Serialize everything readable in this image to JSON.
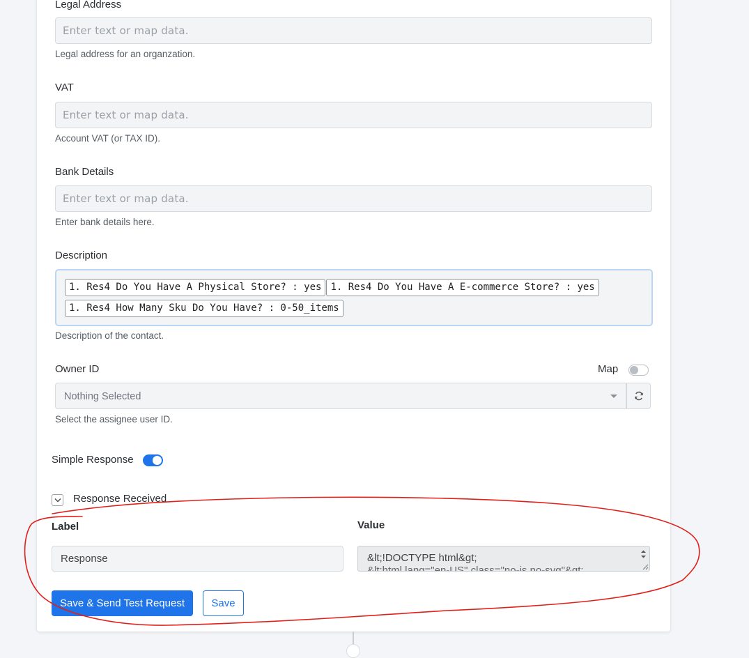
{
  "fields": {
    "legal_address": {
      "label": "Legal Address",
      "placeholder": "Enter text or map data.",
      "help": "Legal address for an organzation."
    },
    "vat": {
      "label": "VAT",
      "placeholder": "Enter text or map data.",
      "help": "Account VAT (or TAX ID)."
    },
    "bank_details": {
      "label": "Bank Details",
      "placeholder": "Enter text or map data.",
      "help": "Enter bank details here."
    },
    "description": {
      "label": "Description",
      "tags": [
        "1. Res4 Do You Have A Physical Store? : yes",
        "1. Res4 Do You Have A E-commerce Store? : yes",
        "1. Res4 How Many Sku Do You Have? : 0-50_items"
      ],
      "help": "Description of the contact."
    },
    "owner_id": {
      "label": "Owner ID",
      "map_label": "Map",
      "map_enabled": false,
      "selected": "Nothing Selected",
      "help": "Select the assignee user ID."
    }
  },
  "simple_response": {
    "label": "Simple Response",
    "enabled": true
  },
  "response_received": {
    "label": "Response Received",
    "label_header": "Label",
    "value_header": "Value",
    "label_value": "Response",
    "value_line1": "&lt;!DOCTYPE html&gt;",
    "value_line2": "&lt;html lang=\"en-US\" class=\"no-js no-svg\"&gt;"
  },
  "buttons": {
    "save_and_send": "Save & Send Test Request",
    "save": "Save"
  },
  "colors": {
    "accent": "#1e74e8",
    "annotation": "#e0201b"
  },
  "icons": {
    "refresh": "refresh-icon",
    "chevron": "chevron-down-icon",
    "caret": "caret-down-icon"
  }
}
